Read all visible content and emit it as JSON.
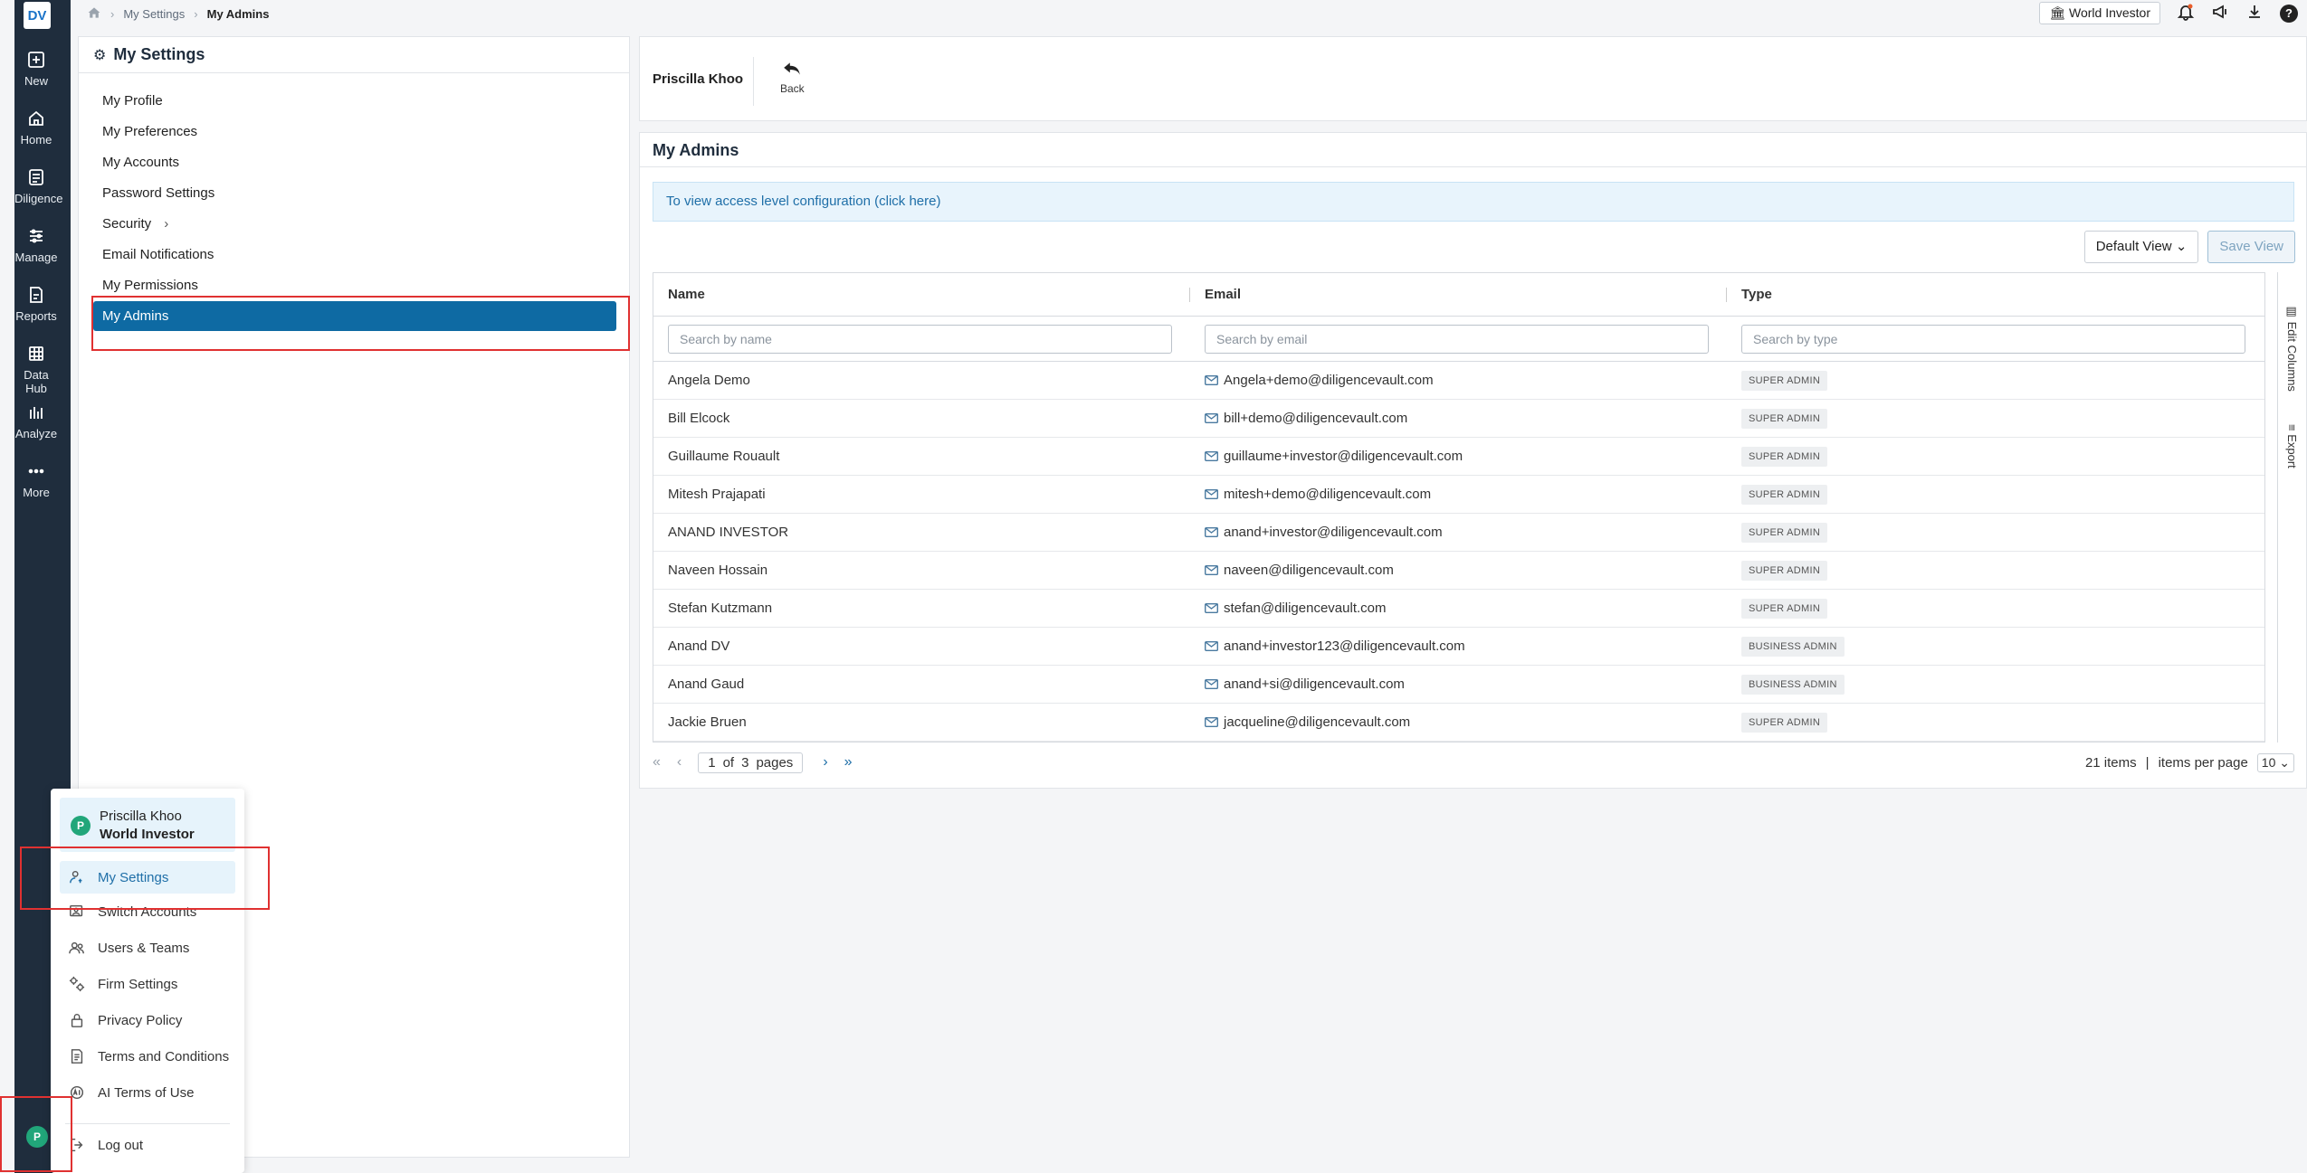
{
  "rail": {
    "logo": "DV",
    "items": [
      {
        "label": "New",
        "icon": "plus-square-icon"
      },
      {
        "label": "Home",
        "icon": "home-icon"
      },
      {
        "label": "Diligence",
        "icon": "diligence-icon"
      },
      {
        "label": "Manage",
        "icon": "manage-icon"
      },
      {
        "label": "Reports",
        "icon": "reports-icon"
      },
      {
        "label": "Data Hub",
        "icon": "grid-icon"
      },
      {
        "label": "Analyze",
        "icon": "bar-chart-icon"
      },
      {
        "label": "More",
        "icon": "more-dots-icon"
      }
    ],
    "avatar_initial": "P"
  },
  "breadcrumb": {
    "items": [
      "My Settings",
      "My Admins"
    ]
  },
  "topbar": {
    "investor": "World Investor"
  },
  "settings": {
    "title": "My Settings",
    "items": [
      "My Profile",
      "My Preferences",
      "My Accounts",
      "Password Settings",
      "Security",
      "Email Notifications",
      "My Permissions",
      "My Admins"
    ],
    "active": "My Admins"
  },
  "user_panel": {
    "name": "Priscilla Khoo",
    "back_label": "Back"
  },
  "admins": {
    "title": "My Admins",
    "info": "To view access level configuration (click here)",
    "view_select": "Default View",
    "save_view": "Save View",
    "columns": [
      "Name",
      "Email",
      "Type"
    ],
    "placeholders": {
      "name": "Search by name",
      "email": "Search by email",
      "type": "Search by type"
    },
    "rows": [
      {
        "name": "Angela Demo",
        "email": "Angela+demo@diligencevault.com",
        "type": "SUPER ADMIN"
      },
      {
        "name": "Bill Elcock",
        "email": "bill+demo@diligencevault.com",
        "type": "SUPER ADMIN"
      },
      {
        "name": "Guillaume Rouault",
        "email": "guillaume+investor@diligencevault.com",
        "type": "SUPER ADMIN"
      },
      {
        "name": "Mitesh Prajapati",
        "email": "mitesh+demo@diligencevault.com",
        "type": "SUPER ADMIN"
      },
      {
        "name": "ANAND INVESTOR",
        "email": "anand+investor@diligencevault.com",
        "type": "SUPER ADMIN"
      },
      {
        "name": "Naveen Hossain",
        "email": "naveen@diligencevault.com",
        "type": "SUPER ADMIN"
      },
      {
        "name": "Stefan Kutzmann",
        "email": "stefan@diligencevault.com",
        "type": "SUPER ADMIN"
      },
      {
        "name": "Anand DV",
        "email": "anand+investor123@diligencevault.com",
        "type": "BUSINESS ADMIN"
      },
      {
        "name": "Anand Gaud",
        "email": "anand+si@diligencevault.com",
        "type": "BUSINESS ADMIN"
      },
      {
        "name": "Jackie Bruen",
        "email": "jacqueline@diligencevault.com",
        "type": "SUPER ADMIN"
      }
    ],
    "side_tools": [
      "Edit Columns",
      "Export"
    ],
    "pager": {
      "page": "1",
      "of": "of",
      "total_pages": "3",
      "pages_label": "pages",
      "items_total": "21 items",
      "divider": "|",
      "per_page_label": "items per page",
      "per_page": "10"
    }
  },
  "user_menu": {
    "avatar_initial": "P",
    "name": "Priscilla Khoo",
    "firm": "World Investor",
    "items": [
      {
        "label": "My Settings",
        "icon": "user-settings-icon"
      },
      {
        "label": "Switch Accounts",
        "icon": "switch-accounts-icon"
      },
      {
        "label": "Users & Teams",
        "icon": "users-icon"
      },
      {
        "label": "Firm Settings",
        "icon": "gears-icon"
      },
      {
        "label": "Privacy Policy",
        "icon": "lock-icon"
      },
      {
        "label": "Terms and Conditions",
        "icon": "document-icon"
      },
      {
        "label": "AI Terms of Use",
        "icon": "ai-icon"
      },
      {
        "label": "Log out",
        "icon": "logout-icon"
      }
    ]
  },
  "colors": {
    "rail_bg": "#1f2d3d",
    "accent": "#0e6aa3",
    "highlight": "#e03131",
    "avatar": "#21a67a"
  }
}
